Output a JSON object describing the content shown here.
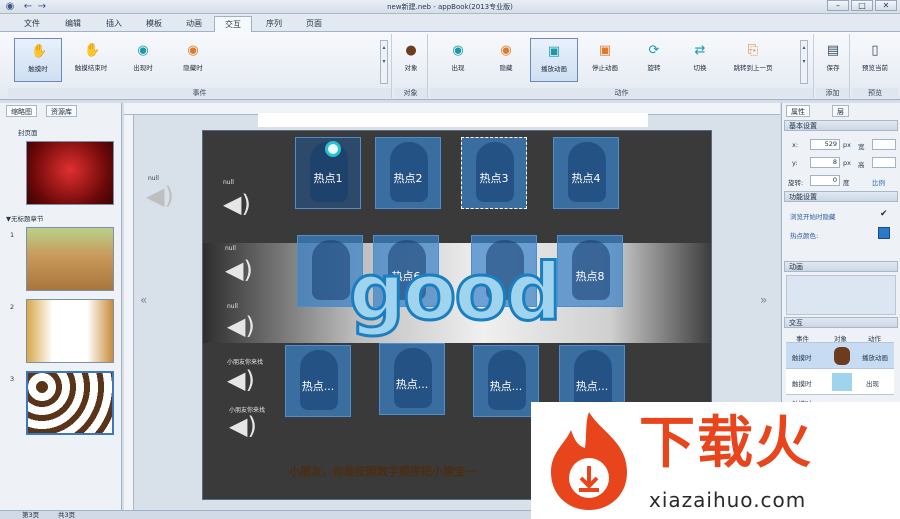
{
  "app": {
    "title": "new新建.neb - appBook(2013专业版)"
  },
  "menu_tabs": [
    "文件",
    "编辑",
    "插入",
    "模板",
    "动画",
    "交互",
    "序列",
    "页面"
  ],
  "ribbon": {
    "event_buttons": [
      "触摸时",
      "触摸结束时",
      "出现时",
      "隐藏时"
    ],
    "event_group": "事件",
    "object_button": "对象",
    "object_group": "对象",
    "action_buttons": [
      "出现",
      "隐藏",
      "播放动画",
      "停止动画",
      "旋转",
      "切换",
      "跳转到上一页"
    ],
    "action_group": "动作",
    "save_button": "保存",
    "save_group": "添加",
    "preview_button": "预览当前",
    "preview_group": "预览"
  },
  "left_panel": {
    "tabs": [
      "缩略图",
      "资源库"
    ],
    "cover_label": "封页面",
    "chapter_label": "▼无标题章节",
    "page_numbers": [
      "1",
      "2",
      "3"
    ]
  },
  "stage": {
    "hotspot_label": "热点",
    "hotspot_rows": [
      [
        "热点1",
        "热点2",
        "热点3",
        "热点4"
      ],
      [
        "",
        "热点6",
        "",
        "热点8"
      ],
      [
        "热点...",
        "热点...",
        "热点...",
        "热点..."
      ]
    ],
    "speaker_labels": [
      "null",
      "null",
      "null",
      "null",
      "小朋友你来找",
      "小朋友你来找"
    ],
    "good_text": "good",
    "caption": "小朋友，你能按照数字顺序把小猴宝一"
  },
  "right_panel": {
    "tabs": [
      "属性",
      "层"
    ],
    "basic_section": "基本设置",
    "x_label": "x:",
    "x_value": "529",
    "y_label": "y:",
    "y_value": "8",
    "w_label": "宽",
    "h_label": "高",
    "unit": "px",
    "rotate_label": "旋转:",
    "rotate_value": "0",
    "rotate_unit": "度",
    "ratio_label": "比例",
    "function_section": "功能设置",
    "hide_label": "浏览开始时隐藏",
    "hotspot_color_label": "热点颜色:",
    "animation_section": "动画",
    "interaction_section": "交互",
    "interaction_cols": [
      "事件",
      "对象",
      "动作"
    ],
    "interaction_rows": [
      {
        "event": "触摸时",
        "action": "播放动画"
      },
      {
        "event": "触摸时",
        "action": "出现"
      },
      {
        "event": "触摸时",
        "action": ""
      }
    ]
  },
  "status": {
    "page": "第3页",
    "total": "共3页"
  },
  "watermark": {
    "text": "下载火",
    "url": "xiazaihuo.com"
  },
  "colors": {
    "accent": "#1a7fc0",
    "watermark": "#e8451c"
  }
}
